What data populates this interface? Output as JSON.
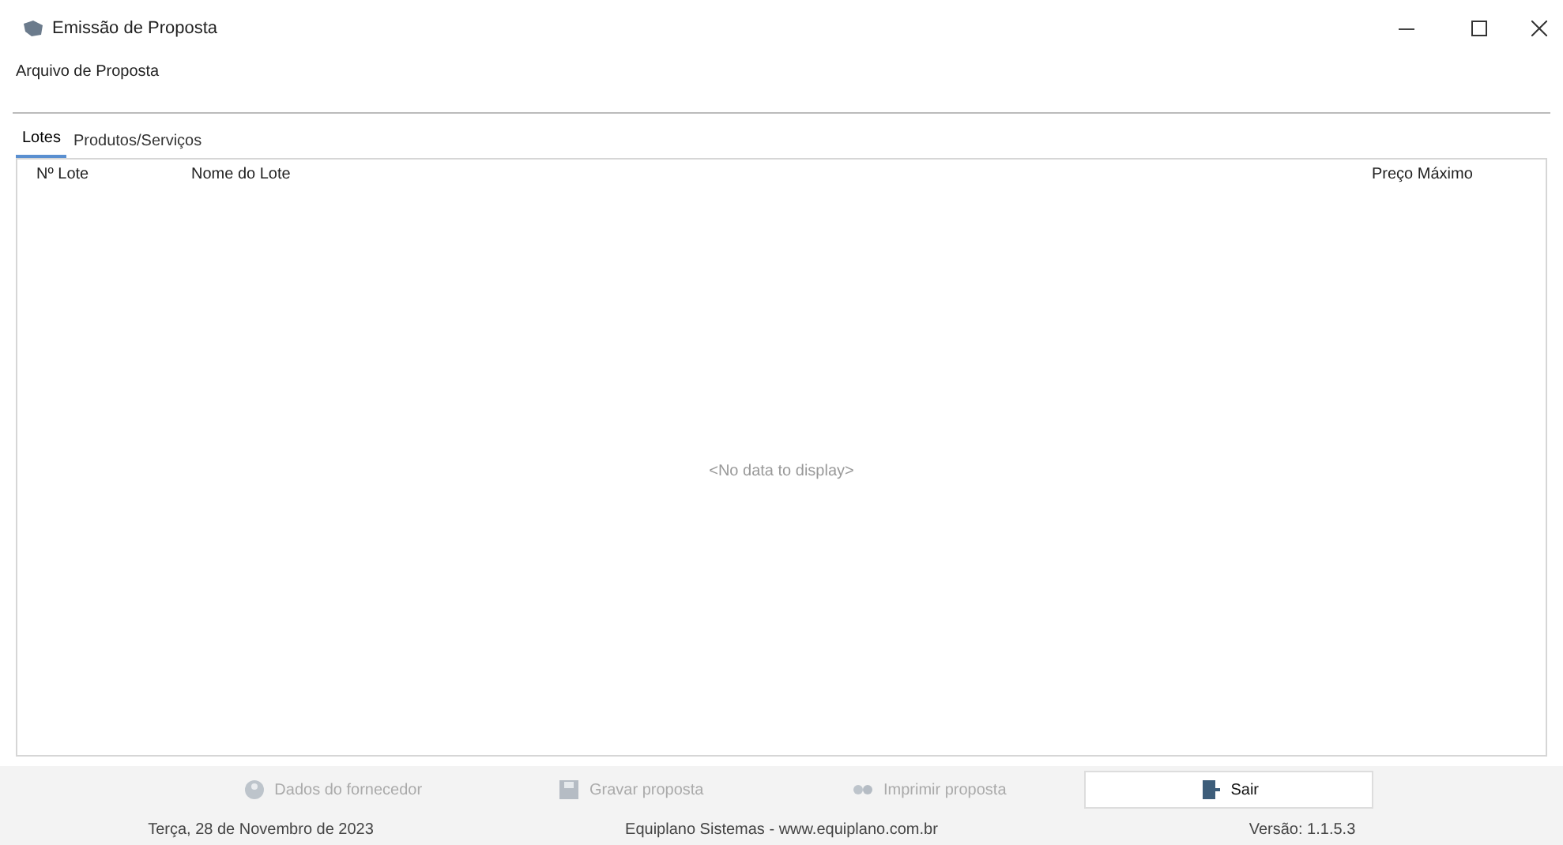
{
  "window": {
    "title": "Emissão de Proposta"
  },
  "menu": [
    "Arquivo de Proposta"
  ],
  "tabs": [
    {
      "label": "Lotes",
      "selected": true
    },
    {
      "label": "Produtos/Serviços",
      "selected": false
    }
  ],
  "table": {
    "columns": [
      "Nº Lote",
      "Nome do Lote",
      "Preço Máximo"
    ],
    "empty_text": "<No data to display>"
  },
  "buttons": [
    {
      "label": "Dados do fornecedor",
      "disabled": true,
      "kind": "supplier"
    },
    {
      "label": "Gravar proposta",
      "disabled": true,
      "kind": "save"
    },
    {
      "label": "Imprimir proposta",
      "disabled": true,
      "kind": "print"
    },
    {
      "label": "Sair",
      "disabled": false,
      "kind": "exit"
    }
  ],
  "status_bar": [
    "Terça, 28 de Novembro de 2023",
    "Equiplano Sistemas - www.equiplano.com.br",
    "Versão: 1.1.5.3"
  ]
}
